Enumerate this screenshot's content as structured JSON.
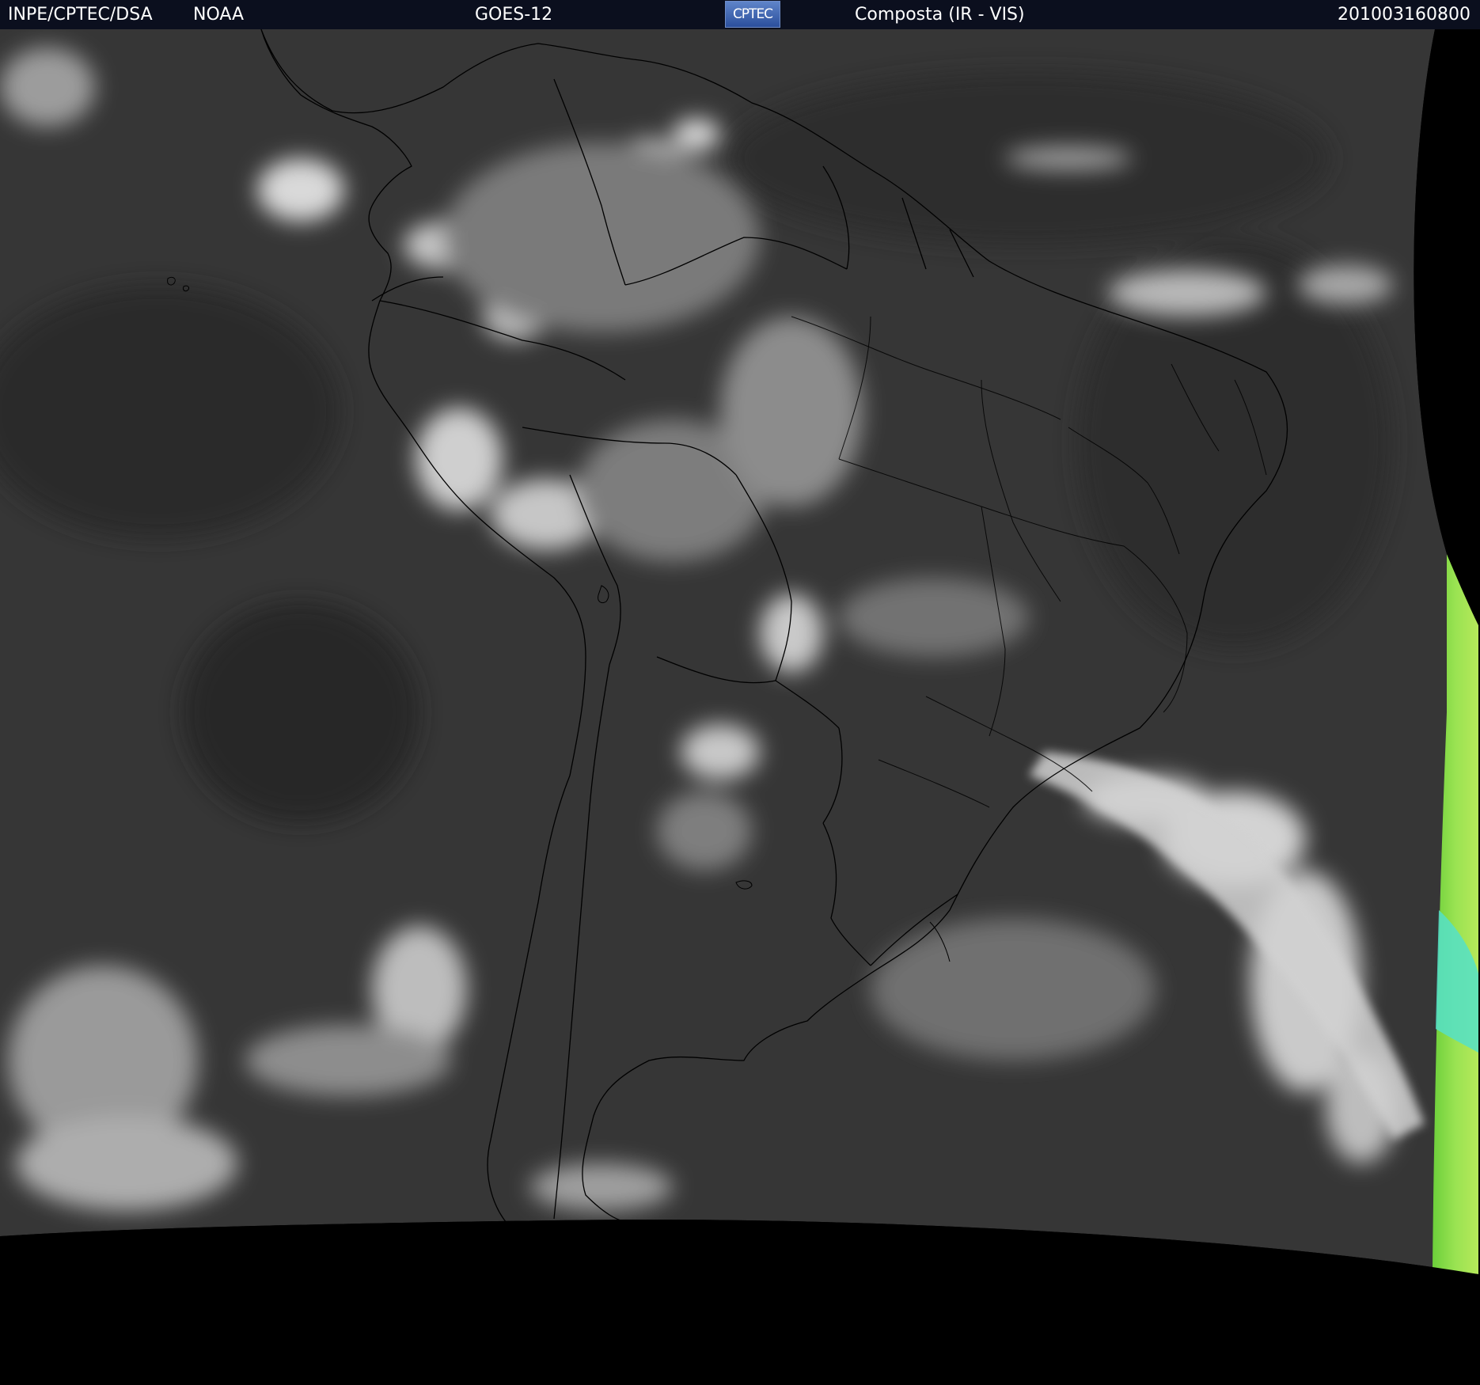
{
  "header": {
    "agency": "INPE/CPTEC/DSA",
    "partner": "NOAA",
    "satellite": "GOES-12",
    "logo_text": "CPTEC",
    "product": "Composta (IR - VIS)",
    "timestamp": "201003160800"
  },
  "colors": {
    "header_bg": "#0b0f1e",
    "space": "#000000",
    "cloud_free": "#3a3a3a",
    "cloud": "#d8d8d8",
    "ir_edge_green": "#8fe04a",
    "ir_edge_cyan": "#55e0c8",
    "borders": "#000000"
  },
  "map": {
    "region": "South America",
    "layers": [
      "satellite-imagery",
      "country-borders",
      "state-borders",
      "coastlines"
    ]
  }
}
